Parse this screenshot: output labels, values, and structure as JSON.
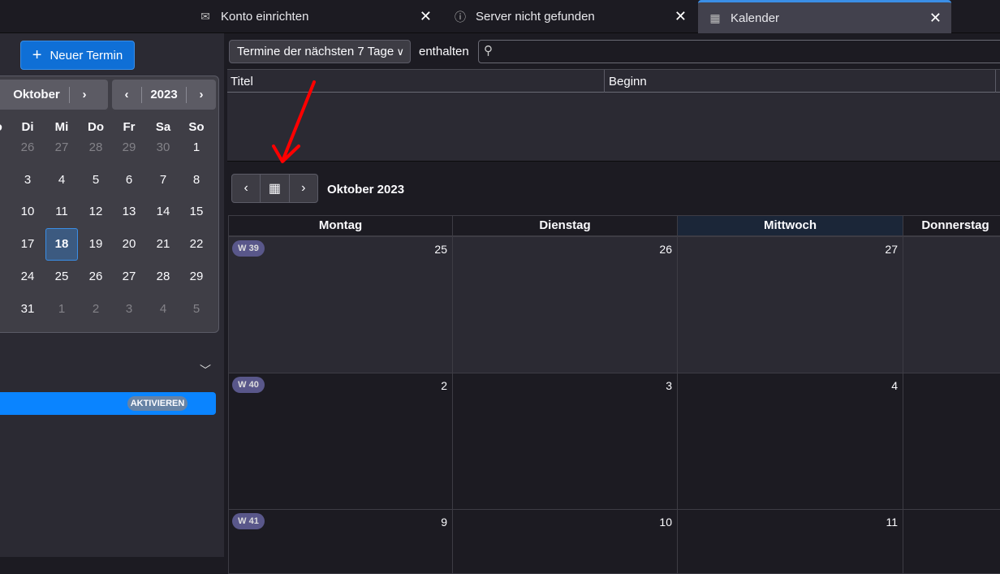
{
  "tabs": [
    {
      "label": "Konto einrichten",
      "icon": "mail-add-icon"
    },
    {
      "label": "Server nicht gefunden",
      "icon": "info-icon"
    },
    {
      "label": "Kalender",
      "icon": "calendar-icon",
      "active": true
    }
  ],
  "sidebar": {
    "new_event": "Neuer Termin",
    "month": "Oktober",
    "year": "2023",
    "weekdays": [
      "Mo",
      "Di",
      "Mi",
      "Do",
      "Fr",
      "Sa",
      "So"
    ],
    "weeks": [
      [
        "26",
        "27",
        "28",
        "29",
        "30",
        "1"
      ],
      [
        "3",
        "4",
        "5",
        "6",
        "7",
        "8"
      ],
      [
        "10",
        "11",
        "12",
        "13",
        "14",
        "15"
      ],
      [
        "17",
        "18",
        "19",
        "20",
        "21",
        "22"
      ],
      [
        "24",
        "25",
        "26",
        "27",
        "28",
        "29"
      ],
      [
        "31",
        "1",
        "2",
        "3",
        "4",
        "5"
      ]
    ],
    "today": "18",
    "activate_label": "AKTIVIEREN"
  },
  "filter": {
    "selected": "Termine der nächsten 7 Tage",
    "contains_label": "enthalten",
    "search_value": ""
  },
  "list": {
    "columns": [
      "Titel",
      "Beginn"
    ]
  },
  "view": {
    "title": "Oktober 2023",
    "days": [
      "Montag",
      "Dienstag",
      "Mittwoch",
      "Donnerstag"
    ],
    "weeks": [
      {
        "label": "W 39",
        "dates": [
          "25",
          "26",
          "27",
          ""
        ]
      },
      {
        "label": "W 40",
        "dates": [
          "2",
          "3",
          "4",
          ""
        ]
      },
      {
        "label": "W 41",
        "dates": [
          "9",
          "10",
          "11",
          ""
        ]
      }
    ]
  },
  "colors": {
    "accent": "#0a84ff",
    "annotation": "#ff0000"
  }
}
